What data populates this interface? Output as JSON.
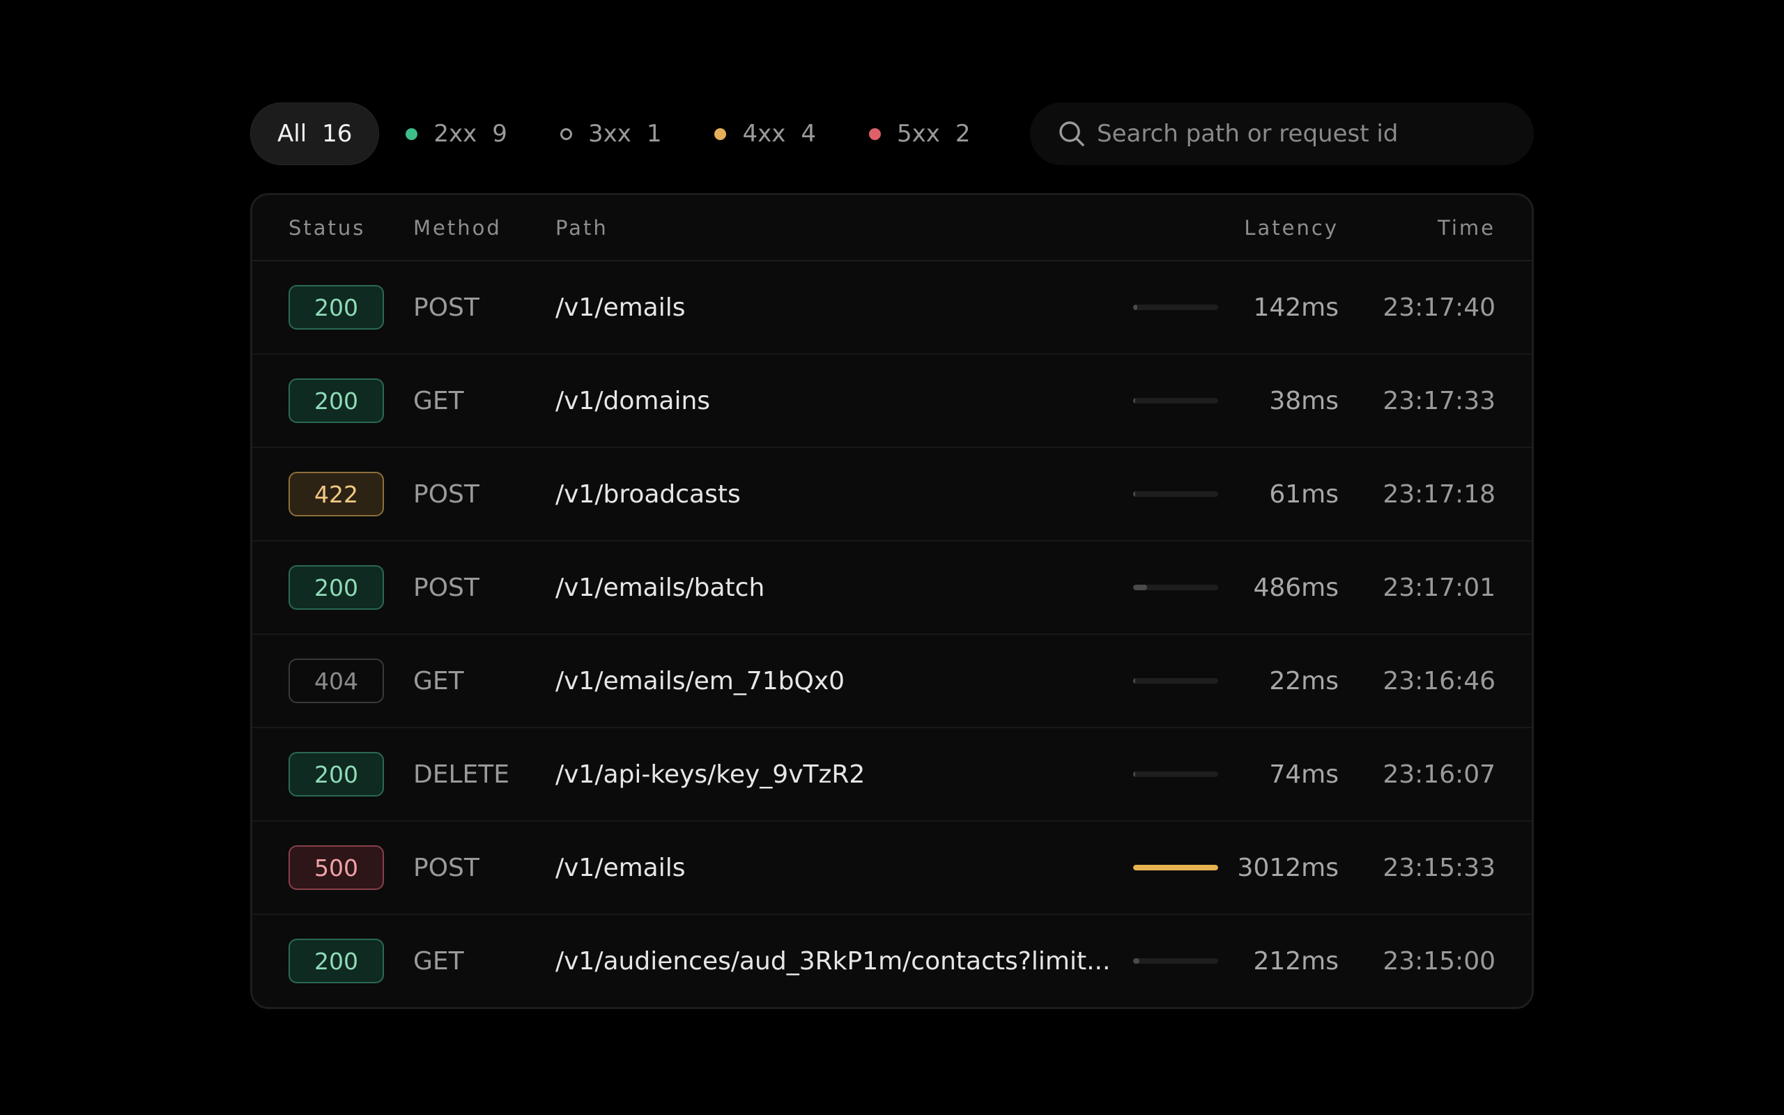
{
  "filters": [
    {
      "label": "All",
      "count": "16",
      "active": true,
      "dot": null
    },
    {
      "label": "2xx",
      "count": "9",
      "active": false,
      "dot": {
        "color": "#3ebf8a",
        "filled": true
      }
    },
    {
      "label": "3xx",
      "count": "1",
      "active": false,
      "dot": {
        "color": "#9a9a9a",
        "filled": false
      }
    },
    {
      "label": "4xx",
      "count": "4",
      "active": false,
      "dot": {
        "color": "#e5b05a",
        "filled": true
      }
    },
    {
      "label": "5xx",
      "count": "2",
      "active": false,
      "dot": {
        "color": "#e0606a",
        "filled": true
      }
    }
  ],
  "search": {
    "placeholder": "Search path or request id",
    "icon": "search-icon"
  },
  "table": {
    "headers": {
      "status": "Status",
      "method": "Method",
      "path": "Path",
      "latency": "Latency",
      "time": "Time"
    },
    "max_latency_ms": 3012,
    "rows": [
      {
        "status": "200",
        "method": "POST",
        "path": "/v1/emails",
        "latency": "142ms",
        "latency_ms": 142,
        "time": "23:17:40"
      },
      {
        "status": "200",
        "method": "GET",
        "path": "/v1/domains",
        "latency": "38ms",
        "latency_ms": 38,
        "time": "23:17:33"
      },
      {
        "status": "422",
        "method": "POST",
        "path": "/v1/broadcasts",
        "latency": "61ms",
        "latency_ms": 61,
        "time": "23:17:18"
      },
      {
        "status": "200",
        "method": "POST",
        "path": "/v1/emails/batch",
        "latency": "486ms",
        "latency_ms": 486,
        "time": "23:17:01"
      },
      {
        "status": "404",
        "method": "GET",
        "path": "/v1/emails/em_71bQx0",
        "latency": "22ms",
        "latency_ms": 22,
        "time": "23:16:46"
      },
      {
        "status": "200",
        "method": "DELETE",
        "path": "/v1/api-keys/key_9vTzR2",
        "latency": "74ms",
        "latency_ms": 74,
        "time": "23:16:07"
      },
      {
        "status": "500",
        "method": "POST",
        "path": "/v1/emails",
        "latency": "3012ms",
        "latency_ms": 3012,
        "time": "23:15:33"
      },
      {
        "status": "200",
        "method": "GET",
        "path": "/v1/audiences/aud_3RkP1m/contacts?limit...",
        "latency": "212ms",
        "latency_ms": 212,
        "time": "23:15:00"
      }
    ]
  },
  "colors": {
    "slow_bar": "#e5b34f",
    "normal_bar": "#4a4a4a"
  }
}
